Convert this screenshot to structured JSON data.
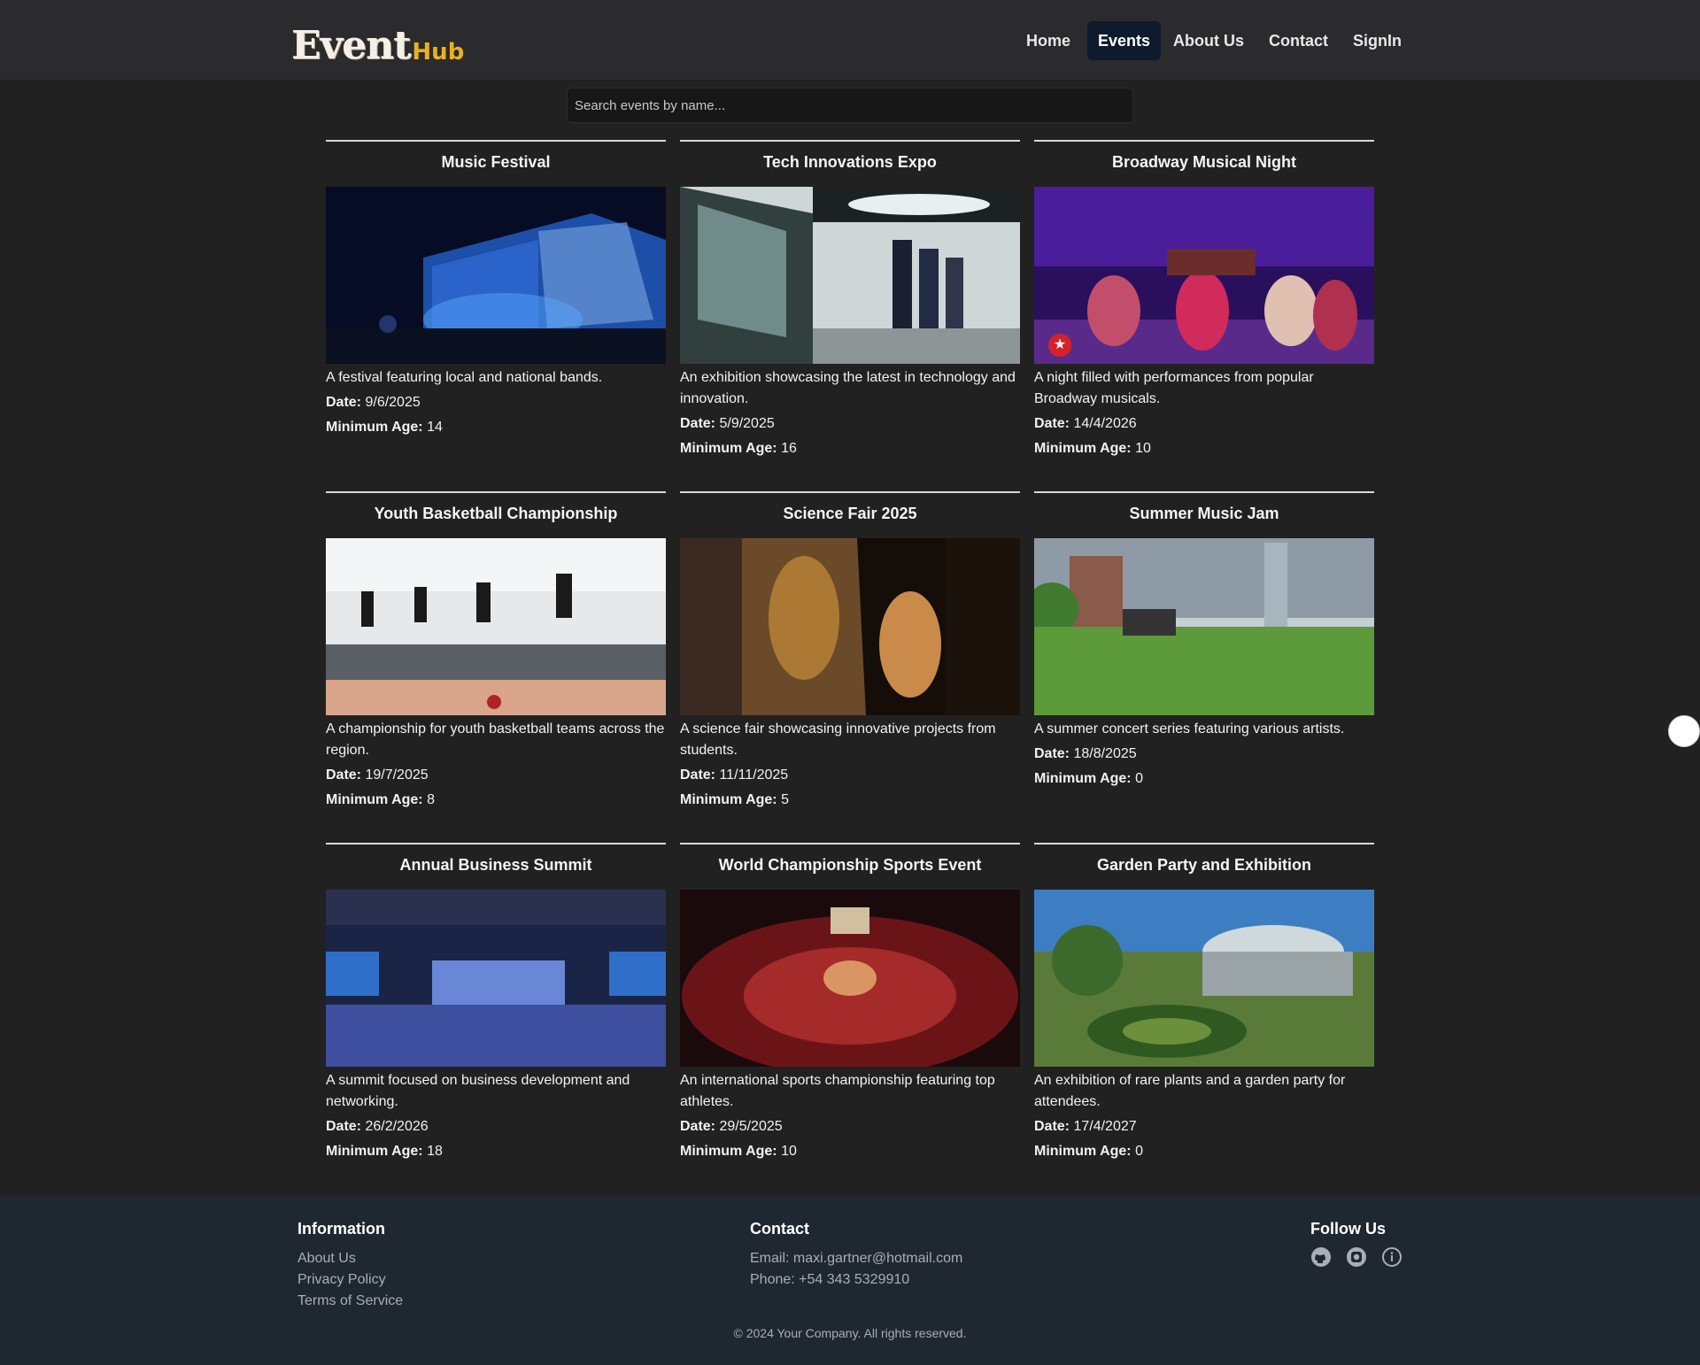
{
  "header": {
    "logo_main": "Event",
    "logo_sub": "Hub",
    "nav": [
      {
        "label": "Home",
        "active": false
      },
      {
        "label": "Events",
        "active": true
      },
      {
        "label": "About Us",
        "active": false
      },
      {
        "label": "Contact",
        "active": false
      },
      {
        "label": "SignIn",
        "active": false
      }
    ]
  },
  "search": {
    "placeholder": "Search events by name...",
    "value": ""
  },
  "events": [
    {
      "title": "Music Festival",
      "description": "A festival featuring local and national bands.",
      "date_label": "Date:",
      "date": "9/6/2025",
      "age_label": "Minimum Age:",
      "min_age": "14",
      "image_icon": "concert-stage-image"
    },
    {
      "title": "Tech Innovations Expo",
      "description": "An exhibition showcasing the latest in technology and innovation.",
      "date_label": "Date:",
      "date": "5/9/2025",
      "age_label": "Minimum Age:",
      "min_age": "16",
      "image_icon": "tech-expo-image"
    },
    {
      "title": "Broadway Musical Night",
      "description": "A night filled with performances from popular Broadway musicals.",
      "date_label": "Date:",
      "date": "14/4/2026",
      "age_label": "Minimum Age:",
      "min_age": "10",
      "image_icon": "broadway-stage-image"
    },
    {
      "title": "Youth Basketball Championship",
      "description": "A championship for youth basketball teams across the region.",
      "date_label": "Date:",
      "date": "19/7/2025",
      "age_label": "Minimum Age:",
      "min_age": "8",
      "image_icon": "basketball-gym-image"
    },
    {
      "title": "Science Fair 2025",
      "description": "A science fair showcasing innovative projects from students.",
      "date_label": "Date:",
      "date": "11/11/2025",
      "age_label": "Minimum Age:",
      "min_age": "5",
      "image_icon": "science-fair-image"
    },
    {
      "title": "Summer Music Jam",
      "description": "A summer concert series featuring various artists.",
      "date_label": "Date:",
      "date": "18/8/2025",
      "age_label": "Minimum Age:",
      "min_age": "0",
      "image_icon": "outdoor-concert-image"
    },
    {
      "title": "Annual Business Summit",
      "description": "A summit focused on business development and networking.",
      "date_label": "Date:",
      "date": "26/2/2026",
      "age_label": "Minimum Age:",
      "min_age": "18",
      "image_icon": "business-summit-image"
    },
    {
      "title": "World Championship Sports Event",
      "description": "An international sports championship featuring top athletes.",
      "date_label": "Date:",
      "date": "29/5/2025",
      "age_label": "Minimum Age:",
      "min_age": "10",
      "image_icon": "stadium-image"
    },
    {
      "title": "Garden Party and Exhibition",
      "description": "An exhibition of rare plants and a garden party for attendees.",
      "date_label": "Date:",
      "date": "17/4/2027",
      "age_label": "Minimum Age:",
      "min_age": "0",
      "image_icon": "garden-image"
    }
  ],
  "footer": {
    "information": {
      "heading": "Information",
      "links": [
        "About Us",
        "Privacy Policy",
        "Terms of Service"
      ]
    },
    "contact": {
      "heading": "Contact",
      "email": "Email: maxi.gartner@hotmail.com",
      "phone": "Phone: +54 343 5329910"
    },
    "follow": {
      "heading": "Follow Us",
      "icons": [
        "github-icon",
        "instagram-icon",
        "info-icon"
      ]
    },
    "copyright": "© 2024 Your Company. All rights reserved."
  },
  "colors": {
    "background": "#212121",
    "header": "#2b2a2c",
    "footer": "#1f2731",
    "active_nav": "#0d1b2d",
    "logo_accent": "#e8b21f"
  }
}
